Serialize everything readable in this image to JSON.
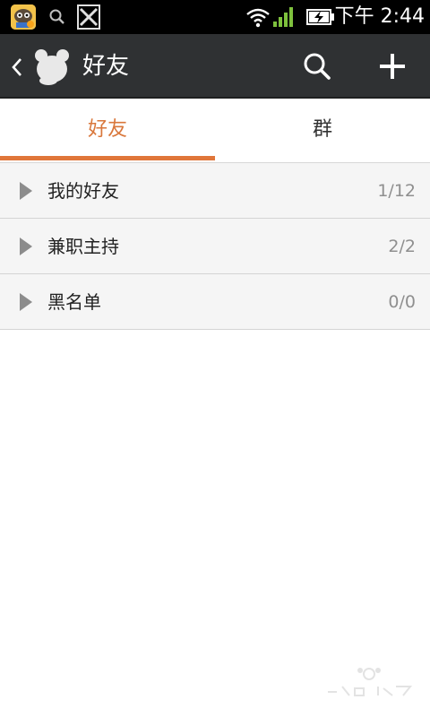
{
  "status_bar": {
    "time": "下午 2:44",
    "icons": [
      "app-notification-icon",
      "search-icon",
      "x-logo-icon",
      "wifi-icon",
      "signal-icon",
      "battery-charging-icon"
    ]
  },
  "header": {
    "title": "好友",
    "icons": [
      "back-chevron-icon",
      "avatar-icon",
      "search-icon",
      "add-icon"
    ]
  },
  "tabs": [
    {
      "label": "好友",
      "active": true
    },
    {
      "label": "群",
      "active": false
    }
  ],
  "groups": [
    {
      "name": "我的好友",
      "count": "1/12"
    },
    {
      "name": "兼职主持",
      "count": "2/2"
    },
    {
      "name": "黑名单",
      "count": "0/0"
    }
  ],
  "colors": {
    "accent": "#e0763a",
    "header_bg": "#2f3133",
    "status_bg": "#000000",
    "row_bg": "#f5f5f5"
  }
}
